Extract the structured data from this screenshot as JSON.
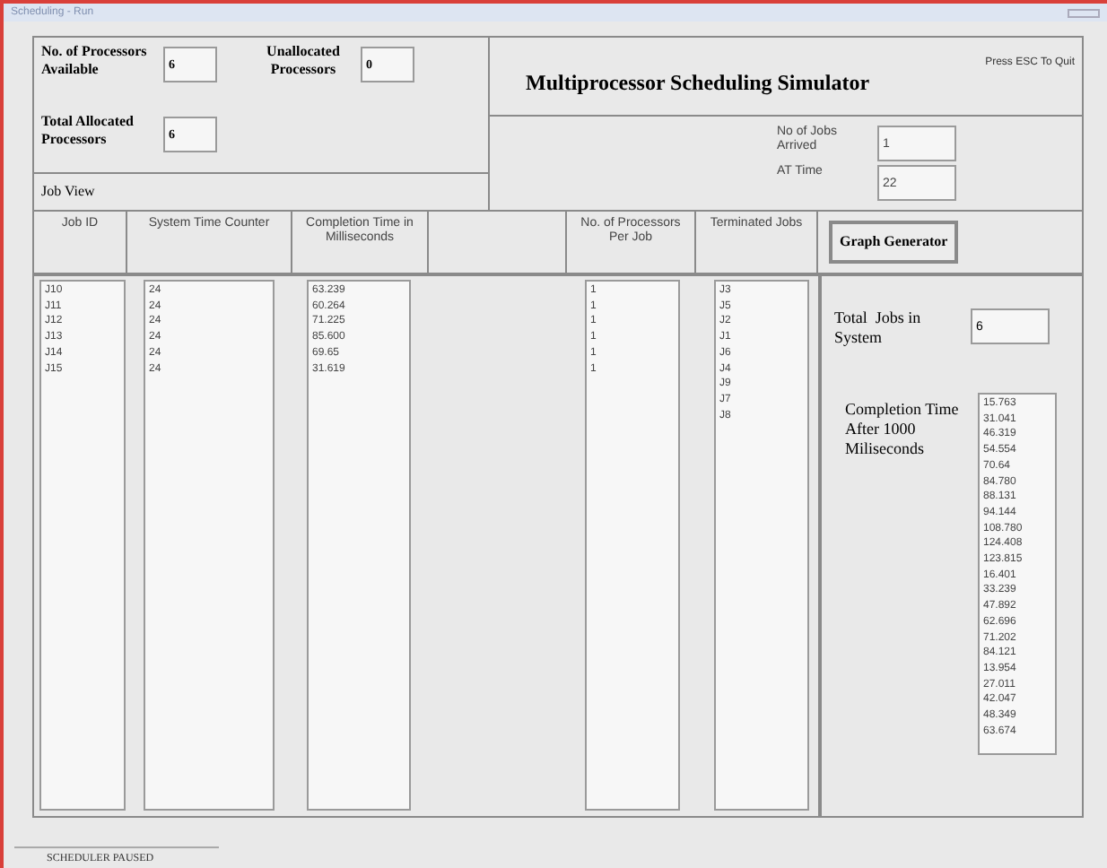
{
  "window": {
    "title": "Scheduling - Run"
  },
  "processors": {
    "available_label": "No. of Processors Available",
    "available": "6",
    "unallocated_label": "Unallocated Processors",
    "unallocated": "0",
    "total_allocated_label": "Total Allocated Processors",
    "total_allocated": "6"
  },
  "job_view_label": "Job View",
  "app_title": "Multiprocessor Scheduling Simulator",
  "esc_hint": "Press ESC To Quit",
  "arrivals": {
    "jobs_arrived_label": "No of Jobs Arrived",
    "jobs_arrived": "1",
    "at_time_label": "AT Time",
    "at_time": "22"
  },
  "columns": [
    "Job ID",
    "System Time Counter",
    "Completion Time in Milliseconds",
    "",
    "No. of Processors Per Job",
    "Terminated Jobs"
  ],
  "lists": {
    "job_id": [
      "J10",
      "J11",
      "J12",
      "J13",
      "J14",
      "J15"
    ],
    "system_time": [
      "24",
      "24",
      "24",
      "24",
      "24",
      "24"
    ],
    "completion_time": [
      "63.239",
      "60.264",
      "71.225",
      "85.600",
      "69.65",
      "31.619"
    ],
    "processors_per_job": [
      "1",
      "1",
      "1",
      "1",
      "1",
      "1"
    ],
    "terminated": [
      "J3",
      "J5",
      "J2",
      "J1",
      "J6",
      "J4",
      "J9",
      "J7",
      "J8"
    ]
  },
  "graph_button": "Graph Generator",
  "total_jobs_label": "Total  Jobs in System",
  "total_jobs": "6",
  "completion_after_label": "Completion Time After 1000 Miliseconds",
  "completion_after": [
    "15.763",
    "31.041",
    "46.319",
    "54.554",
    "70.64",
    "84.780",
    "88.131",
    "94.144",
    "108.780",
    "124.408",
    "123.815",
    "16.401",
    "33.239",
    "47.892",
    "62.696",
    "71.202",
    "84.121",
    "13.954",
    "27.011",
    "42.047",
    "48.349",
    "63.674"
  ],
  "status_bar": "SCHEDULER PAUSED"
}
